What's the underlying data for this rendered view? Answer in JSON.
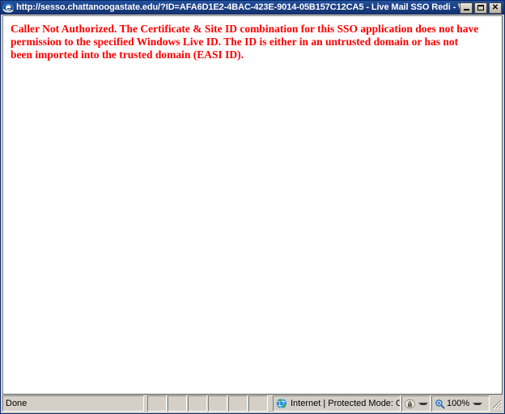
{
  "window": {
    "title": "http://sesso.chattanoogastate.edu/?ID=AFA6D1E2-4BAC-423E-9014-05B157C12CA5 - Live Mail SSO Redi - Windo...",
    "app_icon": "internet-explorer-icon",
    "controls": {
      "minimize_label": "_",
      "maximize_label": "□",
      "close_label": "✕"
    },
    "titlebar_color": "#1c4084"
  },
  "content": {
    "error_message": "Caller Not Authorized. The Certificate & Site ID combination for this SSO application does not have permission to the specified Windows Live ID. The ID is either in an untrusted domain or has not been imported into the trusted domain (EASI ID).",
    "error_color": "#ff0000",
    "background_color": "#ffffff"
  },
  "statusbar": {
    "status_text": "Done",
    "empty_panels": [
      "",
      "",
      "",
      "",
      "",
      ""
    ],
    "zone_icon": "globe-icon",
    "zone_text": "Internet | Protected Mode: Off",
    "privacy_icon": "privacy-lock-icon",
    "privacy_caret": "chevron-down-icon",
    "zoom_icon": "magnifier-icon",
    "zoom_level": "100%",
    "zoom_caret": "chevron-down-icon",
    "resize_grip": "resize-grip-icon"
  }
}
